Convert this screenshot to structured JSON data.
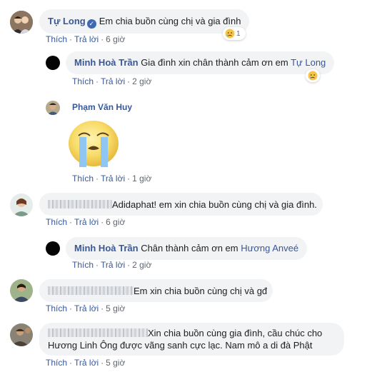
{
  "comments": [
    {
      "name": "Tự Long",
      "text": "Em chia buồn cùng chị và gia đình",
      "reaction_count": "1",
      "like": "Thích",
      "reply": "Trả lời",
      "time": "6 giờ"
    },
    {
      "name": "Minh Hoà Trần",
      "text": "Gia đình xin chân thành cảm ơn em",
      "mention": "Tự Long",
      "like": "Thích",
      "reply": "Trả lời",
      "time": "2 giờ"
    },
    {
      "name": "Phạm Văn Huy",
      "sticker": "crying-face-sticker",
      "like": "Thích",
      "reply": "Trả lời",
      "time": "1 giờ"
    },
    {
      "text": "Adidaphat! em xin chia buồn cùng chị và gia đình.",
      "like": "Thích",
      "reply": "Trả lời",
      "time": "6 giờ"
    },
    {
      "name": "Minh Hoà Trần",
      "text": "Chân thành cảm ơn em",
      "mention": "Hương Anveé",
      "like": "Thích",
      "reply": "Trả lời",
      "time": "2 giờ"
    },
    {
      "text": "Em xin chia buồn cùng chị và gđ",
      "like": "Thích",
      "reply": "Trả lời",
      "time": "5 giờ"
    },
    {
      "text_line1": "Xin chia buồn cùng gia đình, cầu chúc cho",
      "text_line2": "Hương Linh Ông được vãng sanh cực lạc. Nam mô a di đà Phật",
      "like": "Thích",
      "reply": "Trả lời",
      "time": "5 giờ"
    }
  ],
  "separator": "·",
  "colors": {
    "link": "#385898",
    "bubble": "#f2f3f5",
    "meta": "#606770"
  }
}
